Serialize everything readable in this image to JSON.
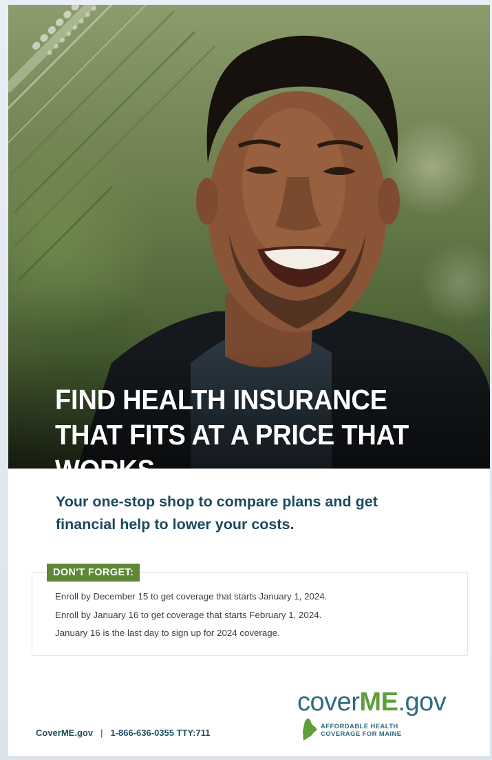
{
  "poster": {
    "headline": "FIND HEALTH INSURANCE THAT FITS AT A PRICE THAT WORKS.",
    "subhead": "Your one-stop shop to compare plans and get financial help to lower your costs.",
    "reminder": {
      "badge": "DON'T FORGET:",
      "lines": [
        "Enroll by December 15 to get coverage that starts January 1, 2024.",
        "Enroll by January 16 to get coverage that starts February 1, 2024.",
        "January 16 is the last day to sign up for 2024 coverage."
      ]
    },
    "footer": {
      "site": "CoverME.gov",
      "separator": "|",
      "phone": "1-866-636-0355 TTY:711"
    },
    "logo": {
      "prefix": "cover",
      "middle": "ME",
      "suffix": ".gov",
      "tagline_line1": "AFFORDABLE HEALTH",
      "tagline_line2": "COVERAGE FOR MAINE"
    }
  },
  "colors": {
    "headline_text": "#ffffff",
    "subhead_text": "#1b4a5e",
    "badge_green": "#5e8837",
    "logo_teal": "#2e6b80",
    "logo_green": "#5f9e3b"
  }
}
